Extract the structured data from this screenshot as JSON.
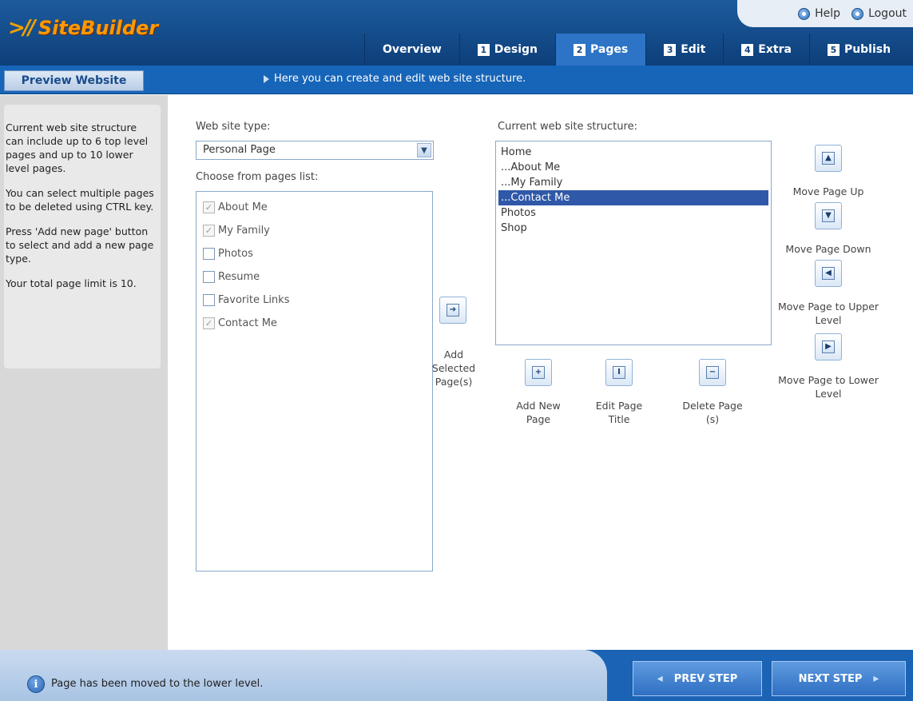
{
  "app": {
    "logo_text": "SiteBuilder"
  },
  "top_links": {
    "help": "Help",
    "logout": "Logout"
  },
  "tabs": [
    {
      "label": "Overview",
      "num": ""
    },
    {
      "label": "Design",
      "num": "1"
    },
    {
      "label": "Pages",
      "num": "2",
      "active": true
    },
    {
      "label": "Edit",
      "num": "3"
    },
    {
      "label": "Extra",
      "num": "4"
    },
    {
      "label": "Publish",
      "num": "5"
    }
  ],
  "subbar": {
    "preview_label": "Preview Website",
    "hint": "Here you can create and edit web site structure."
  },
  "help": [
    "Current web site structure can include up to 6 top level pages and up to 10 lower level pages.",
    "You can select multiple pages to be deleted using CTRL key.",
    "Press 'Add new page' button to select and add a new page type.",
    "Your total page limit is 10."
  ],
  "main": {
    "site_type_label": "Web site type:",
    "site_type_value": "Personal Page",
    "pages_list_label": "Choose from pages list:",
    "pages_list": [
      {
        "label": "About Me",
        "checked": true,
        "disabled": true
      },
      {
        "label": "My Family",
        "checked": true,
        "disabled": true
      },
      {
        "label": "Photos",
        "checked": false
      },
      {
        "label": "Resume",
        "checked": false
      },
      {
        "label": "Favorite Links",
        "checked": false
      },
      {
        "label": "Contact Me",
        "checked": true,
        "disabled": true
      }
    ],
    "add_selected_label": [
      "Add",
      "Selected",
      "Page(s)"
    ],
    "structure_label": "Current web site structure:",
    "structure": [
      {
        "label": "Home"
      },
      {
        "label": "...About Me"
      },
      {
        "label": "...My Family"
      },
      {
        "label": "...Contact Me",
        "selected": true
      },
      {
        "label": "Photos"
      },
      {
        "label": "Shop"
      }
    ],
    "add_new_label": [
      "Add New",
      "Page"
    ],
    "edit_title_label": [
      "Edit Page",
      "Title"
    ],
    "delete_label": [
      "Delete Page",
      "(s)"
    ],
    "move_up_label": "Move Page Up",
    "move_down_label": "Move Page Down",
    "move_upper_label": [
      "Move Page to Upper",
      "Level"
    ],
    "move_lower_label": [
      "Move Page to Lower",
      "Level"
    ]
  },
  "footer": {
    "status": "Page has been moved to the lower level.",
    "prev_label": "PREV STEP",
    "next_label": "NEXT STEP"
  },
  "colors": {
    "header": "#1d5b9d",
    "accent": "#1765b8",
    "selection": "#2f58a8",
    "logo": "#ff9900"
  }
}
